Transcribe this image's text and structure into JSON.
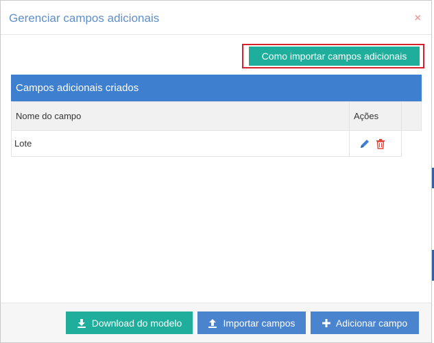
{
  "modal": {
    "title": "Gerenciar campos adicionais",
    "close_symbol": "×"
  },
  "help_button": {
    "label": "Como importar campos adicionais"
  },
  "panel": {
    "title": "Campos adicionais criados",
    "columns": [
      "Nome do campo",
      "Ações"
    ],
    "rows": [
      {
        "name": "Lote",
        "actions": [
          "pencil-icon",
          "trash-icon"
        ]
      }
    ]
  },
  "footer": {
    "download_label": "Download do modelo",
    "import_label": "Importar campos",
    "add_label": "Adicionar campo"
  },
  "colors": {
    "title": "#5e8fc9",
    "teal": "#1fae9c",
    "blue": "#3e80cf",
    "highlight_border": "#d6202b",
    "edit_icon": "#3e80cf",
    "delete_icon": "#e0453a"
  }
}
